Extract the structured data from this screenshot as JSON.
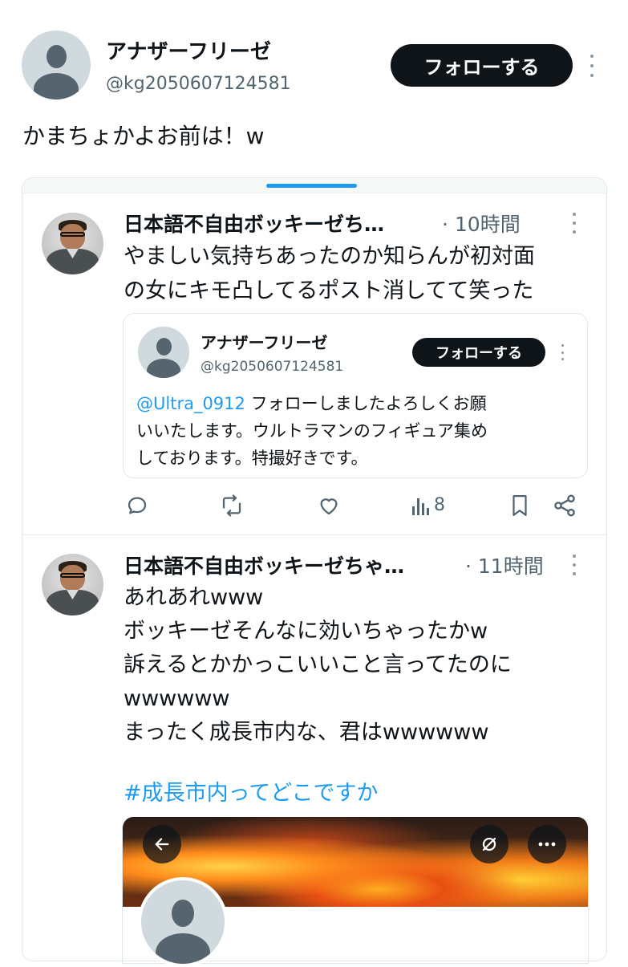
{
  "top_tweet": {
    "display_name": "アナザーフリーゼ",
    "handle": "@kg2050607124581",
    "follow_label": "フォローする",
    "text": "かまちょかよお前は！w"
  },
  "thread": {
    "reply1": {
      "display_name": "日本語不自由ボッキーゼち…",
      "time": "· 10時間",
      "text": "やましい気持ちあったのか知らんが初対面\nの女にキモ凸してるポスト消してて笑った",
      "quote": {
        "display_name": "アナザーフリーゼ",
        "handle": "@kg2050607124581",
        "follow_label": "フォローする",
        "mention": "@Ultra_0912",
        "text_first": " フォローしましたよろしくお願",
        "text_rest": "いいたします。ウルトラマンのフィギュア集め\nしております。特撮好きです。"
      },
      "actions": {
        "views": "8"
      }
    },
    "reply2": {
      "display_name": "日本語不自由ボッキーゼちゃ…",
      "time": "· 11時間",
      "text": "あれあれwww\nボッキーゼそんなに効いちゃったかw\n訴えるとかかっこいいこと言ってたのに\nwwwwww\nまったく成長市内な、君はwwwwww",
      "hashtag": "#成長市内ってどこですか"
    }
  },
  "colors": {
    "link": "#1d9bf0",
    "follow_bg": "#0f1419",
    "tab_indicator": "#1d9bf0"
  }
}
